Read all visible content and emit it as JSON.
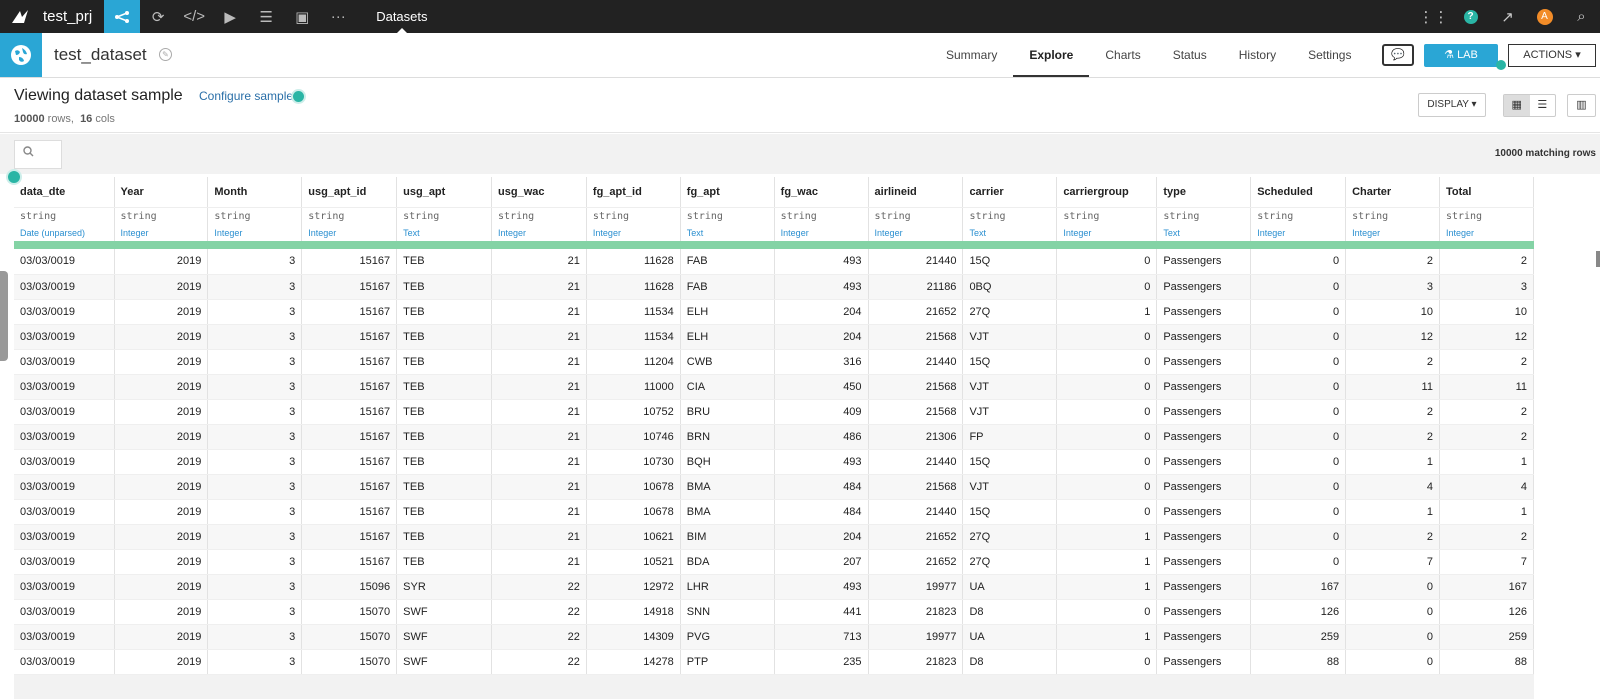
{
  "topnav": {
    "project": "test_prj",
    "current": "Datasets",
    "icons": [
      "flow-icon",
      "refresh-icon",
      "code-icon",
      "play-icon",
      "stack-icon",
      "dashboard-icon",
      "more-icon"
    ]
  },
  "topright": {
    "help": "?",
    "avatar": "A"
  },
  "header": {
    "title": "test_dataset",
    "tabs": [
      "Summary",
      "Explore",
      "Charts",
      "Status",
      "History",
      "Settings"
    ],
    "active_tab": "Explore",
    "lab_label": "LAB",
    "actions_label": "ACTIONS"
  },
  "subhead": {
    "title": "Viewing dataset sample",
    "configure": "Configure sample",
    "rows": "10000",
    "rows_label": "rows,",
    "cols": "16",
    "cols_label": "cols",
    "display_label": "DISPLAY"
  },
  "search": {
    "matching": "10000 matching rows"
  },
  "table": {
    "columns": [
      {
        "name": "data_dte",
        "type": "string",
        "meaning": "Date (unparsed)",
        "align": "left"
      },
      {
        "name": "Year",
        "type": "string",
        "meaning": "Integer",
        "align": "right"
      },
      {
        "name": "Month",
        "type": "string",
        "meaning": "Integer",
        "align": "right"
      },
      {
        "name": "usg_apt_id",
        "type": "string",
        "meaning": "Integer",
        "align": "right"
      },
      {
        "name": "usg_apt",
        "type": "string",
        "meaning": "Text",
        "align": "left"
      },
      {
        "name": "usg_wac",
        "type": "string",
        "meaning": "Integer",
        "align": "right"
      },
      {
        "name": "fg_apt_id",
        "type": "string",
        "meaning": "Integer",
        "align": "right"
      },
      {
        "name": "fg_apt",
        "type": "string",
        "meaning": "Text",
        "align": "left"
      },
      {
        "name": "fg_wac",
        "type": "string",
        "meaning": "Integer",
        "align": "right"
      },
      {
        "name": "airlineid",
        "type": "string",
        "meaning": "Integer",
        "align": "right"
      },
      {
        "name": "carrier",
        "type": "string",
        "meaning": "Text",
        "align": "left"
      },
      {
        "name": "carriergroup",
        "type": "string",
        "meaning": "Integer",
        "align": "right"
      },
      {
        "name": "type",
        "type": "string",
        "meaning": "Text",
        "align": "left"
      },
      {
        "name": "Scheduled",
        "type": "string",
        "meaning": "Integer",
        "align": "right"
      },
      {
        "name": "Charter",
        "type": "string",
        "meaning": "Integer",
        "align": "right"
      },
      {
        "name": "Total",
        "type": "string",
        "meaning": "Integer",
        "align": "right"
      }
    ],
    "rows": [
      [
        "03/03/0019",
        "2019",
        "3",
        "15167",
        "TEB",
        "21",
        "11628",
        "FAB",
        "493",
        "21440",
        "15Q",
        "0",
        "Passengers",
        "0",
        "2",
        "2"
      ],
      [
        "03/03/0019",
        "2019",
        "3",
        "15167",
        "TEB",
        "21",
        "11628",
        "FAB",
        "493",
        "21186",
        "0BQ",
        "0",
        "Passengers",
        "0",
        "3",
        "3"
      ],
      [
        "03/03/0019",
        "2019",
        "3",
        "15167",
        "TEB",
        "21",
        "11534",
        "ELH",
        "204",
        "21652",
        "27Q",
        "1",
        "Passengers",
        "0",
        "10",
        "10"
      ],
      [
        "03/03/0019",
        "2019",
        "3",
        "15167",
        "TEB",
        "21",
        "11534",
        "ELH",
        "204",
        "21568",
        "VJT",
        "0",
        "Passengers",
        "0",
        "12",
        "12"
      ],
      [
        "03/03/0019",
        "2019",
        "3",
        "15167",
        "TEB",
        "21",
        "11204",
        "CWB",
        "316",
        "21440",
        "15Q",
        "0",
        "Passengers",
        "0",
        "2",
        "2"
      ],
      [
        "03/03/0019",
        "2019",
        "3",
        "15167",
        "TEB",
        "21",
        "11000",
        "CIA",
        "450",
        "21568",
        "VJT",
        "0",
        "Passengers",
        "0",
        "11",
        "11"
      ],
      [
        "03/03/0019",
        "2019",
        "3",
        "15167",
        "TEB",
        "21",
        "10752",
        "BRU",
        "409",
        "21568",
        "VJT",
        "0",
        "Passengers",
        "0",
        "2",
        "2"
      ],
      [
        "03/03/0019",
        "2019",
        "3",
        "15167",
        "TEB",
        "21",
        "10746",
        "BRN",
        "486",
        "21306",
        "FP",
        "0",
        "Passengers",
        "0",
        "2",
        "2"
      ],
      [
        "03/03/0019",
        "2019",
        "3",
        "15167",
        "TEB",
        "21",
        "10730",
        "BQH",
        "493",
        "21440",
        "15Q",
        "0",
        "Passengers",
        "0",
        "1",
        "1"
      ],
      [
        "03/03/0019",
        "2019",
        "3",
        "15167",
        "TEB",
        "21",
        "10678",
        "BMA",
        "484",
        "21568",
        "VJT",
        "0",
        "Passengers",
        "0",
        "4",
        "4"
      ],
      [
        "03/03/0019",
        "2019",
        "3",
        "15167",
        "TEB",
        "21",
        "10678",
        "BMA",
        "484",
        "21440",
        "15Q",
        "0",
        "Passengers",
        "0",
        "1",
        "1"
      ],
      [
        "03/03/0019",
        "2019",
        "3",
        "15167",
        "TEB",
        "21",
        "10621",
        "BIM",
        "204",
        "21652",
        "27Q",
        "1",
        "Passengers",
        "0",
        "2",
        "2"
      ],
      [
        "03/03/0019",
        "2019",
        "3",
        "15167",
        "TEB",
        "21",
        "10521",
        "BDA",
        "207",
        "21652",
        "27Q",
        "1",
        "Passengers",
        "0",
        "7",
        "7"
      ],
      [
        "03/03/0019",
        "2019",
        "3",
        "15096",
        "SYR",
        "22",
        "12972",
        "LHR",
        "493",
        "19977",
        "UA",
        "1",
        "Passengers",
        "167",
        "0",
        "167"
      ],
      [
        "03/03/0019",
        "2019",
        "3",
        "15070",
        "SWF",
        "22",
        "14918",
        "SNN",
        "441",
        "21823",
        "D8",
        "0",
        "Passengers",
        "126",
        "0",
        "126"
      ],
      [
        "03/03/0019",
        "2019",
        "3",
        "15070",
        "SWF",
        "22",
        "14309",
        "PVG",
        "713",
        "19977",
        "UA",
        "1",
        "Passengers",
        "259",
        "0",
        "259"
      ],
      [
        "03/03/0019",
        "2019",
        "3",
        "15070",
        "SWF",
        "22",
        "14278",
        "PTP",
        "235",
        "21823",
        "D8",
        "0",
        "Passengers",
        "88",
        "0",
        "88"
      ]
    ]
  },
  "colors": {
    "accent": "#2aa6d5",
    "teal": "#2ab5a5",
    "quality_bar": "#84d3a5",
    "nav_bg": "#222222"
  }
}
